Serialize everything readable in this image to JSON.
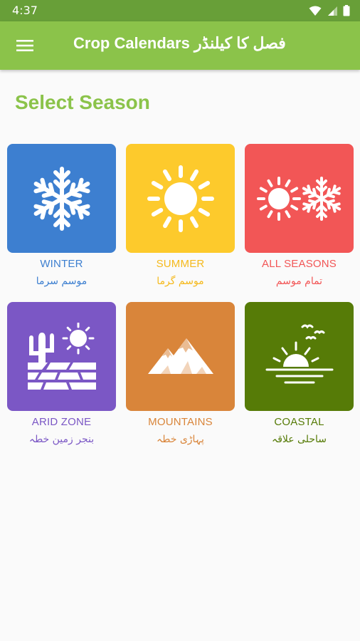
{
  "status_bar": {
    "time": "4:37",
    "icons": [
      "wifi-icon",
      "signal-icon",
      "battery-icon"
    ]
  },
  "app_bar": {
    "menu_icon": "hamburger-menu-icon",
    "title": "Crop Calendars فصل کا کیلنڈر"
  },
  "page": {
    "heading": "Select Season"
  },
  "seasons": [
    {
      "label": "WINTER",
      "urdu": "موسم سرما",
      "color": "#3d7fd0",
      "text_color": "#3d7fd0",
      "icon": "snowflake-icon"
    },
    {
      "label": "SUMMER",
      "urdu": "موسم گرما",
      "color": "#fdca2c",
      "text_color": "#f5b91c",
      "icon": "sun-icon"
    },
    {
      "label": "ALL SEASONS",
      "urdu": "تمام موسم",
      "color": "#f25656",
      "text_color": "#f25656",
      "icon": "sun-and-snowflake-icon"
    },
    {
      "label": "ARID ZONE",
      "urdu": "بنجر زمین خطہ",
      "color": "#7b57c5",
      "text_color": "#7b57c5",
      "icon": "cactus-cracked-land-icon"
    },
    {
      "label": "MOUNTAINS",
      "urdu": "پہاڑی خطہ",
      "color": "#d9853a",
      "text_color": "#d9853a",
      "icon": "mountain-icon"
    },
    {
      "label": "COASTAL",
      "urdu": "ساحلی علاقہ",
      "color": "#567b07",
      "text_color": "#567b07",
      "icon": "sunset-sea-birds-icon"
    }
  ],
  "colors": {
    "app_bar": "#8bc34a",
    "status_bar": "#689f38",
    "heading": "#8bc34a",
    "background": "#fafafa"
  }
}
